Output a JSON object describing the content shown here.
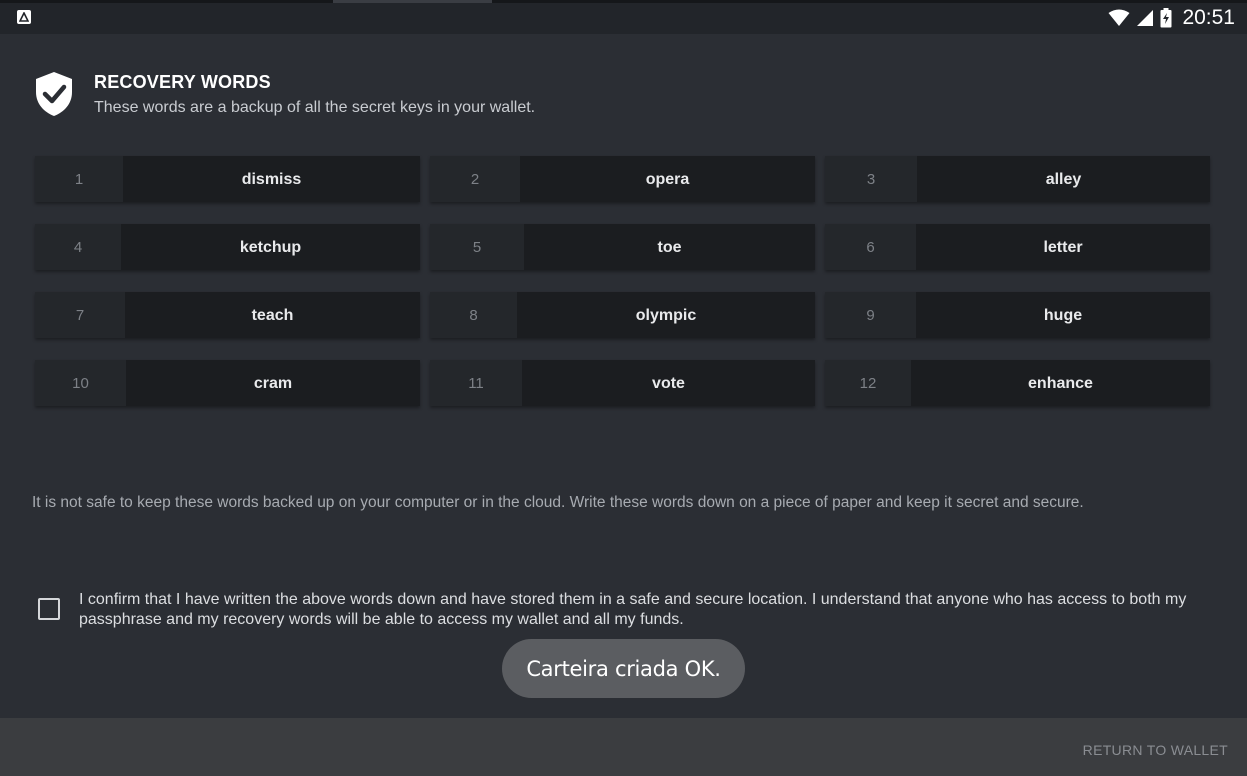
{
  "status_bar": {
    "time": "20:51",
    "app_icon": "app-notification-icon",
    "icons": [
      "wifi-icon",
      "signal-icon",
      "battery-charging-icon"
    ]
  },
  "header": {
    "icon": "shield-check-icon",
    "title": "RECOVERY WORDS",
    "subtitle": "These words are a backup of all the secret keys in your wallet."
  },
  "words": [
    {
      "num": "1",
      "word": "dismiss"
    },
    {
      "num": "2",
      "word": "opera"
    },
    {
      "num": "3",
      "word": "alley"
    },
    {
      "num": "4",
      "word": "ketchup"
    },
    {
      "num": "5",
      "word": "toe"
    },
    {
      "num": "6",
      "word": "letter"
    },
    {
      "num": "7",
      "word": "teach"
    },
    {
      "num": "8",
      "word": "olympic"
    },
    {
      "num": "9",
      "word": "huge"
    },
    {
      "num": "10",
      "word": "cram"
    },
    {
      "num": "11",
      "word": "vote"
    },
    {
      "num": "12",
      "word": "enhance"
    }
  ],
  "warning": "It is not safe to keep these words backed up on your computer or in the cloud. Write these words down on a piece of paper and keep it secret and secure.",
  "confirm": {
    "checked": false,
    "label": "I confirm that I have written the above words down and have stored them in a safe and secure location. I understand that anyone who has access to both my passphrase and my recovery words will be able to access my wallet and all my funds."
  },
  "toast": "Carteira criada OK.",
  "footer": {
    "return_label": "RETURN TO WALLET"
  },
  "colors": {
    "background": "#2b2e34",
    "word_box": "#1b1d20",
    "footer": "#3b3d40",
    "toast": "#5b5d61"
  }
}
